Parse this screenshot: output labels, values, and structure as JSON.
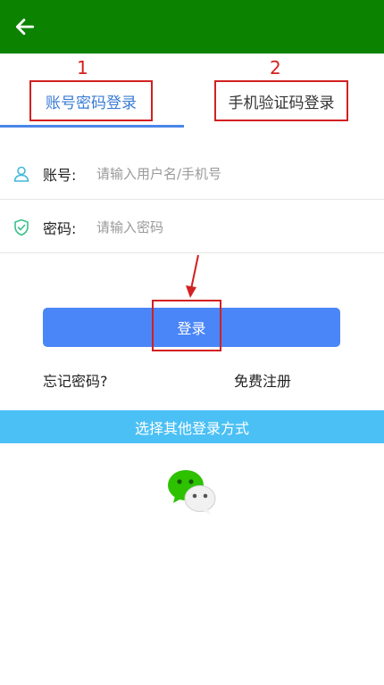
{
  "topbar": {
    "back_icon": "arrow-left-icon",
    "bg_color": "#0b8300"
  },
  "tabs": {
    "annotations": [
      "1",
      "2"
    ],
    "items": [
      {
        "label": "账号密码登录",
        "active": true
      },
      {
        "label": "手机验证码登录",
        "active": false
      }
    ],
    "highlight_color": "#d32020"
  },
  "form": {
    "account": {
      "icon": "user-icon",
      "label": "账号:",
      "placeholder": "请输入用户名/手机号"
    },
    "password": {
      "icon": "shield-check-icon",
      "label": "密码:",
      "placeholder": "请输入密码"
    }
  },
  "login": {
    "label": "登录",
    "color": "#4a86f7"
  },
  "links": {
    "forgot": "忘记密码?",
    "register": "免费注册"
  },
  "other_login": {
    "label": "选择其他登录方式",
    "color": "#4bc0f5",
    "options": [
      {
        "icon": "wechat-icon"
      }
    ]
  }
}
